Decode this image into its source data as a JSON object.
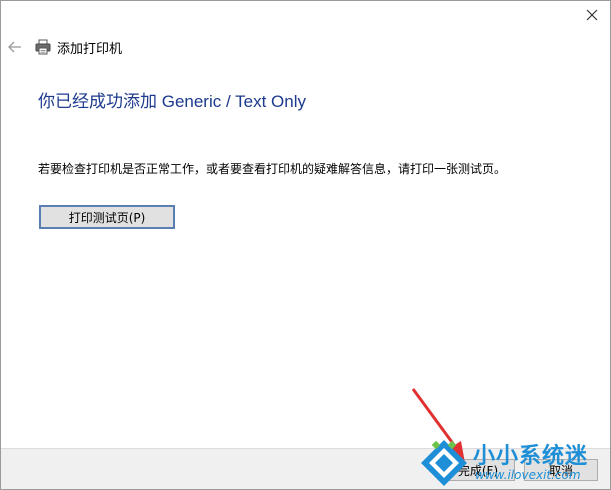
{
  "window": {
    "title": "添加打印机"
  },
  "main": {
    "heading": "你已经成功添加 Generic / Text Only",
    "description": "若要检查打印机是否正常工作，或者要查看打印机的疑难解答信息，请打印一张测试页。",
    "print_test_label": "打印测试页(P)"
  },
  "footer": {
    "finish_label": "完成(F)",
    "cancel_label": "取消"
  },
  "watermark": {
    "title": "小小系统迷",
    "url": "www.ilovexit.com"
  },
  "icons": {
    "close": "close-icon",
    "back": "back-arrow-icon",
    "printer": "printer-icon"
  },
  "colors": {
    "heading": "#1c3a8e",
    "button_focus_border": "#5a7fb3",
    "watermark": "#1e8fd6",
    "arrow": "#e0302f"
  }
}
